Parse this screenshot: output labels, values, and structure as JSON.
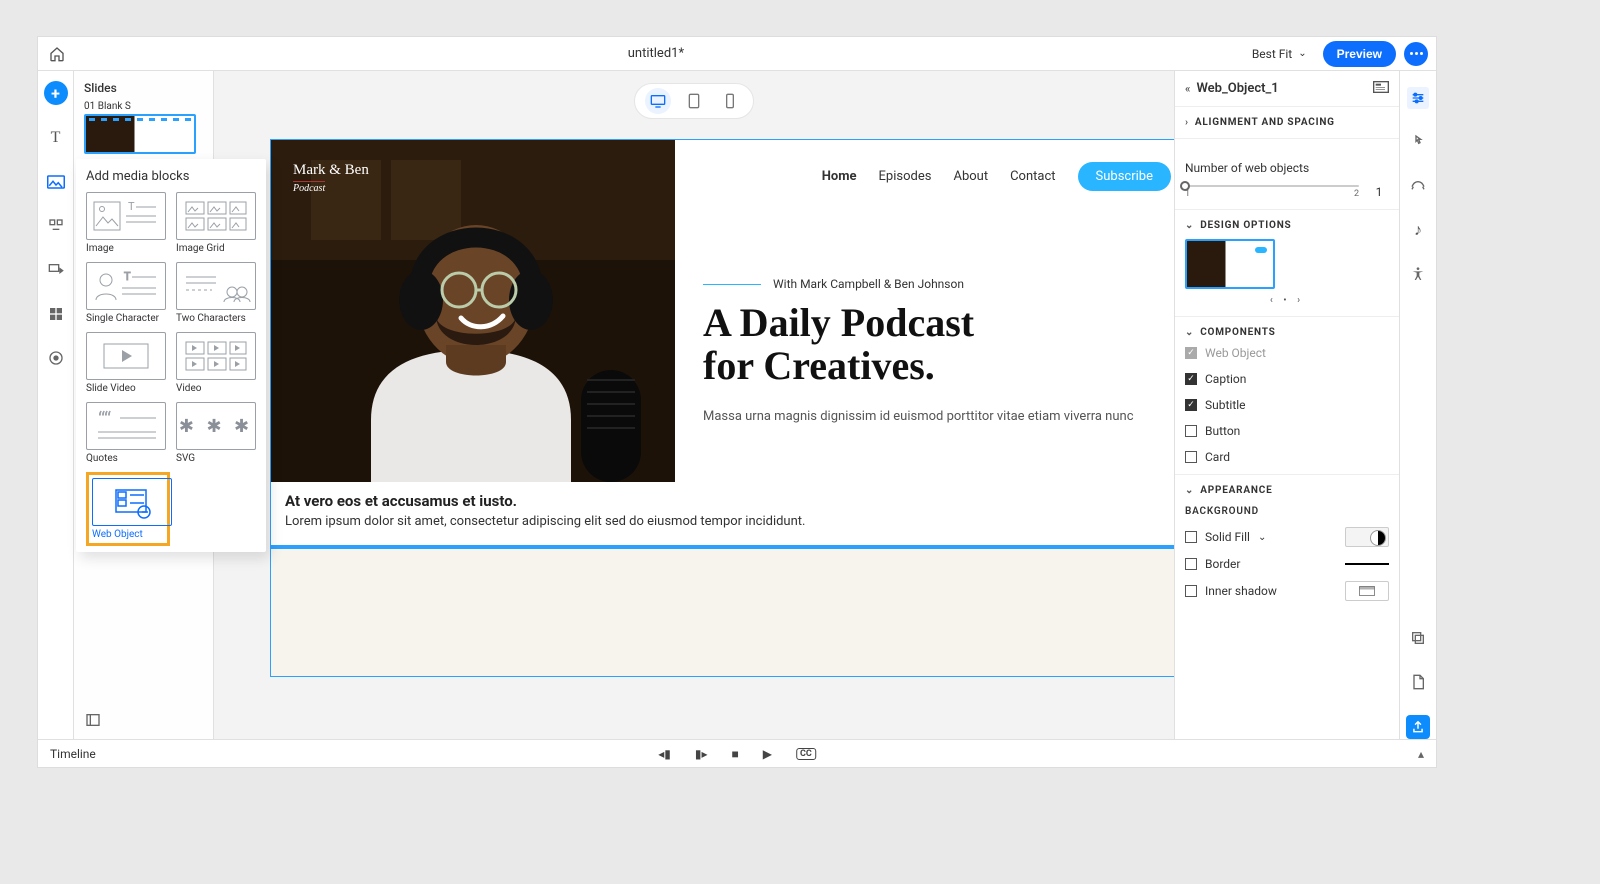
{
  "topbar": {
    "title": "untitled1*",
    "zoom": "Best Fit",
    "preview": "Preview"
  },
  "slides": {
    "panel_title": "Slides",
    "item_label": "01 Blank S"
  },
  "media_popup": {
    "title": "Add media blocks",
    "items": {
      "image": "Image",
      "image_grid": "Image Grid",
      "single_character": "Single Character",
      "two_characters": "Two Characters",
      "slide_video": "Slide Video",
      "video": "Video",
      "quotes": "Quotes",
      "svg": "SVG",
      "web_object": "Web Object"
    }
  },
  "canvas": {
    "brand": {
      "name": "Mark & Ben",
      "sub": "Podcast"
    },
    "nav": {
      "home": "Home",
      "episodes": "Episodes",
      "about": "About",
      "contact": "Contact",
      "subscribe": "Subscribe"
    },
    "overline": "With Mark Campbell & Ben Johnson",
    "headline1": "A Daily Podcast",
    "headline2": "for Creatives.",
    "lead": "Massa urna magnis dignissim id euismod porttitor vitae etiam viverra nunc",
    "caption_title": "At vero eos et accusamus et iusto.",
    "caption_body": "Lorem ipsum dolor sit amet, consectetur adipiscing elit sed do eiusmod tempor incididunt."
  },
  "inspector": {
    "object_name": "Web_Object_1",
    "sections": {
      "alignment": "ALIGNMENT AND SPACING",
      "design": "DESIGN OPTIONS",
      "components": "COMPONENTS",
      "appearance": "APPEARANCE",
      "background": "BACKGROUND"
    },
    "num_objects_label": "Number of web objects",
    "num_objects_value": "1",
    "slider_min": "1",
    "slider_max": "2",
    "components": {
      "web_object": "Web Object",
      "caption": "Caption",
      "subtitle": "Subtitle",
      "button": "Button",
      "card": "Card"
    },
    "appearance": {
      "solid_fill": "Solid Fill",
      "border": "Border",
      "inner_shadow": "Inner shadow"
    }
  },
  "timeline": {
    "label": "Timeline"
  }
}
